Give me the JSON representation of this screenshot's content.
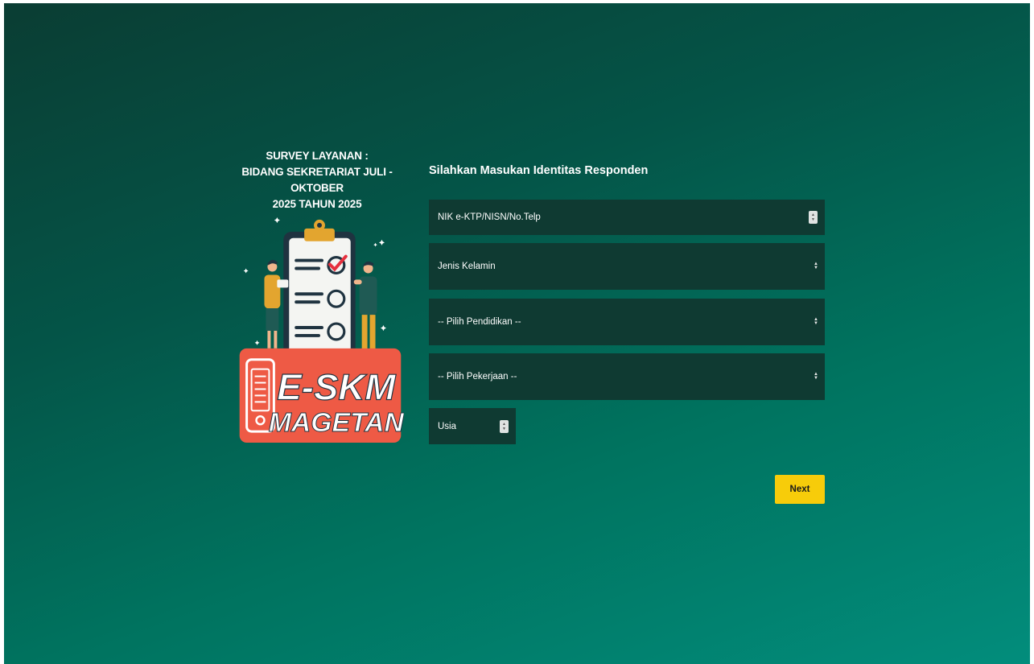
{
  "survey": {
    "title": "SURVEY LAYANAN :\nBIDANG SEKRETARIAT JULI - OKTOBER\n2025 TAHUN 2025"
  },
  "logo": {
    "line1": "E-SKM",
    "line2": "MAGETAN"
  },
  "form": {
    "title": "Silahkan Masukan Identitas Responden",
    "nik_placeholder": "NIK e-KTP/NISN/No.Telp",
    "gender_placeholder": "Jenis Kelamin",
    "education_placeholder": "-- Pilih Pendidikan --",
    "job_placeholder": "-- Pilih Pekerjaan --",
    "age_placeholder": "Usia",
    "next_label": "Next"
  },
  "colors": {
    "bg_dark": "#0a3d33",
    "bg_light": "#028d7c",
    "field_bg": "#0f3a32",
    "button": "#f7cc0a",
    "logo_red": "#ee5a45"
  }
}
